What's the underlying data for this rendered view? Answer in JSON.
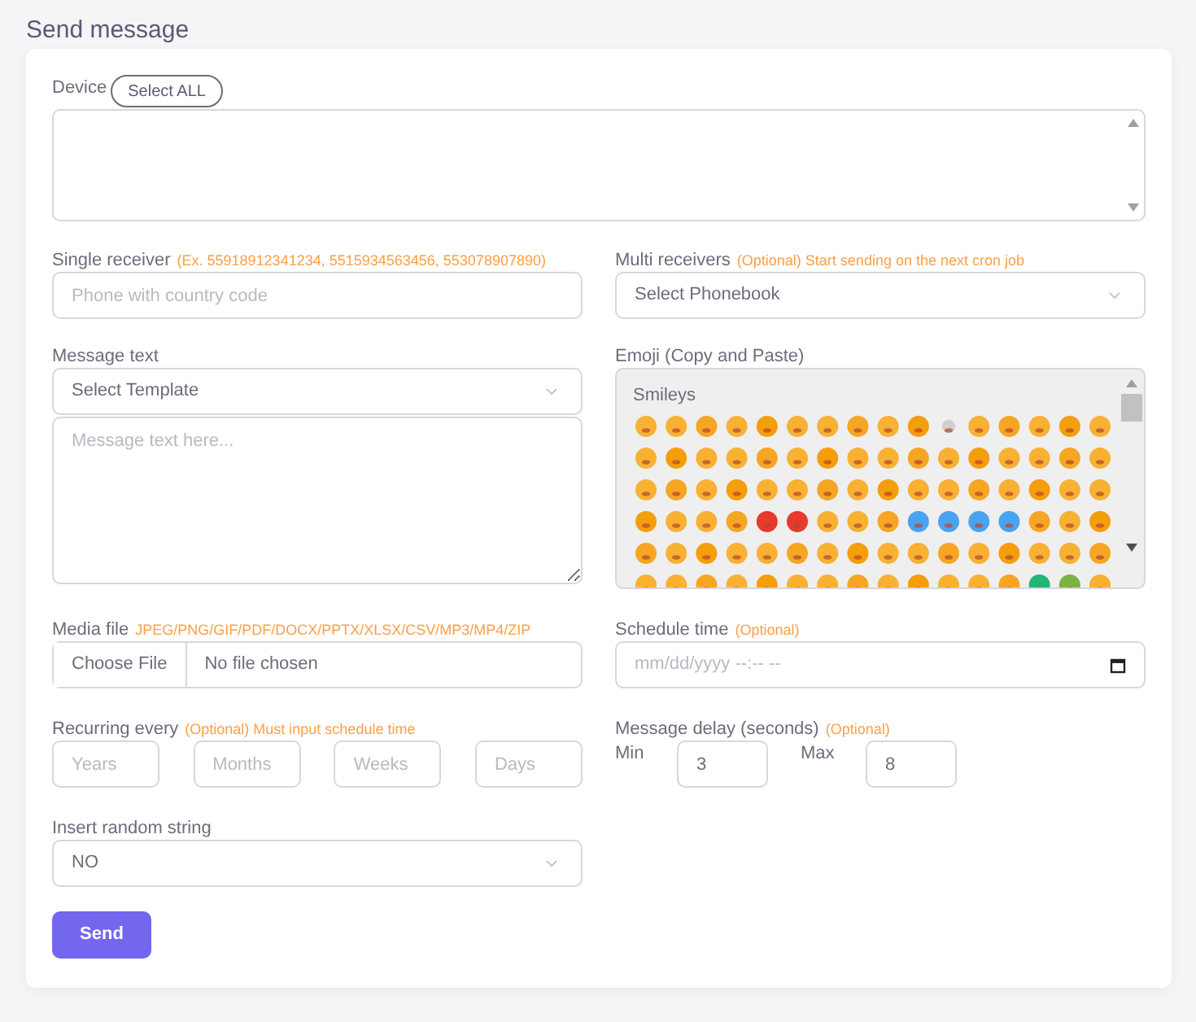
{
  "title": "Send message",
  "device": {
    "label": "Device",
    "button": "Select ALL"
  },
  "single_receiver": {
    "label": "Single receiver",
    "hint": "(Ex. 55918912341234, 5515934563456, 553078907890)",
    "placeholder": "Phone with country code"
  },
  "multi_receivers": {
    "label": "Multi receivers",
    "hint": "(Optional) Start sending on the next cron job",
    "value": "Select Phonebook"
  },
  "message_text": {
    "label": "Message text",
    "template": "Select Template",
    "placeholder": "Message text here..."
  },
  "emoji": {
    "label": "Emoji (Copy and Paste)",
    "category": "Smileys"
  },
  "media_file": {
    "label": "Media file",
    "hint": "JPEG/PNG/GIF/PDF/DOCX/PPTX/XLSX/CSV/MP3/MP4/ZIP",
    "button": "Choose File",
    "status": "No file chosen"
  },
  "schedule_time": {
    "label": "Schedule time",
    "hint": "(Optional)",
    "placeholder": "mm/dd/yyyy --:-- --"
  },
  "recurring": {
    "label": "Recurring every",
    "hint": "(Optional) Must input schedule time",
    "fields": [
      {
        "placeholder": "Years"
      },
      {
        "placeholder": "Months"
      },
      {
        "placeholder": "Weeks"
      },
      {
        "placeholder": "Days"
      }
    ]
  },
  "message_delay": {
    "label": "Message delay (seconds)",
    "hint": "(Optional)",
    "min_label": "Min",
    "min_value": "3",
    "max_label": "Max",
    "max_value": "8"
  },
  "random_string": {
    "label": "Insert random string",
    "value": "NO"
  },
  "send_button": "Send"
}
